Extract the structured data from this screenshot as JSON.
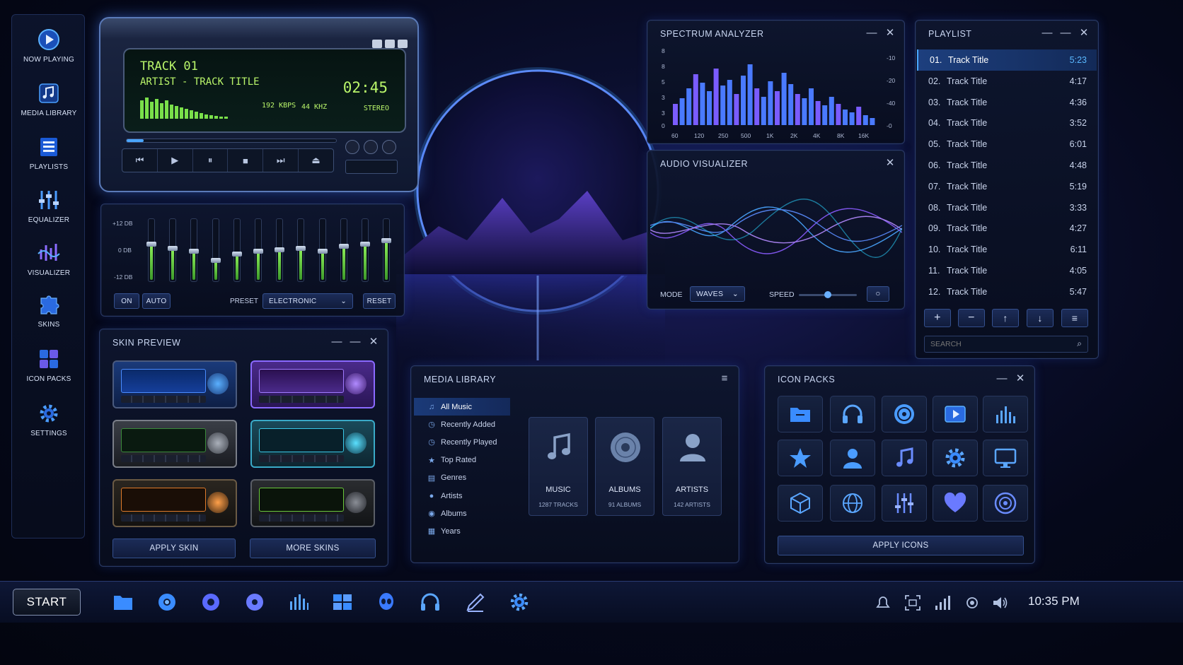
{
  "sidebar": {
    "items": [
      {
        "label": "NOW PLAYING",
        "icon": "play-circle-icon"
      },
      {
        "label": "MEDIA LIBRARY",
        "icon": "music-note-icon"
      },
      {
        "label": "PLAYLISTS",
        "icon": "list-icon"
      },
      {
        "label": "EQUALIZER",
        "icon": "equalizer-icon"
      },
      {
        "label": "VISUALIZER",
        "icon": "visualizer-icon"
      },
      {
        "label": "SKINS",
        "icon": "puzzle-icon"
      },
      {
        "label": "ICON PACKS",
        "icon": "grid-icon"
      },
      {
        "label": "SETTINGS",
        "icon": "gear-icon"
      }
    ]
  },
  "player": {
    "track_no": "TRACK 01",
    "track_info": "ARTIST - TRACK TITLE",
    "time": "02:45",
    "bitrate": "192 KBPS",
    "samplerate": "44 KHZ",
    "mode": "STEREO"
  },
  "equalizer": {
    "top": "+12 DB",
    "mid": "0 DB",
    "bottom": "-12 DB",
    "on_label": "ON",
    "auto_label": "AUTO",
    "preset_label": "PRESET",
    "preset_value": "ELECTRONIC",
    "reset_label": "RESET",
    "levels": [
      0.62,
      0.55,
      0.5,
      0.35,
      0.45,
      0.5,
      0.52,
      0.55,
      0.5,
      0.58,
      0.62,
      0.68
    ]
  },
  "skin_preview": {
    "title": "SKIN PREVIEW",
    "apply_label": "APPLY SKIN",
    "more_label": "MORE SKINS"
  },
  "spectrum": {
    "title": "SPECTRUM ANALYZER",
    "y_ticks": [
      "8",
      "8",
      "5",
      "3",
      "3",
      "0"
    ],
    "right_ticks": [
      "-10",
      "-20",
      "-40",
      "-0"
    ],
    "x_ticks": [
      "60",
      "120",
      "250",
      "500",
      "1K",
      "2K",
      "4K",
      "8K",
      "16K"
    ]
  },
  "visualizer": {
    "title": "AUDIO VISUALIZER",
    "mode_label": "MODE",
    "mode_value": "WAVES",
    "speed_label": "SPEED",
    "speed_level": 0.5
  },
  "playlist": {
    "title": "PLAYLIST",
    "tracks": [
      {
        "num": "01.",
        "title": "Track Title",
        "dur": "5:23"
      },
      {
        "num": "02.",
        "title": "Track Title",
        "dur": "4:17"
      },
      {
        "num": "03.",
        "title": "Track Title",
        "dur": "4:36"
      },
      {
        "num": "04.",
        "title": "Track Title",
        "dur": "3:52"
      },
      {
        "num": "05.",
        "title": "Track Title",
        "dur": "6:01"
      },
      {
        "num": "06.",
        "title": "Track Title",
        "dur": "4:48"
      },
      {
        "num": "07.",
        "title": "Track Title",
        "dur": "5:19"
      },
      {
        "num": "08.",
        "title": "Track Title",
        "dur": "3:33"
      },
      {
        "num": "09.",
        "title": "Track Title",
        "dur": "4:27"
      },
      {
        "num": "10.",
        "title": "Track Title",
        "dur": "6:11"
      },
      {
        "num": "11.",
        "title": "Track Title",
        "dur": "4:05"
      },
      {
        "num": "12.",
        "title": "Track Title",
        "dur": "5:47"
      }
    ],
    "search_placeholder": "SEARCH"
  },
  "media_library": {
    "title": "MEDIA LIBRARY",
    "nav": [
      {
        "label": "All Music",
        "icon": "music-note-icon"
      },
      {
        "label": "Recently Added",
        "icon": "clock-icon"
      },
      {
        "label": "Recently Played",
        "icon": "clock-icon"
      },
      {
        "label": "Top Rated",
        "icon": "star-icon"
      },
      {
        "label": "Genres",
        "icon": "tag-icon"
      },
      {
        "label": "Artists",
        "icon": "user-icon"
      },
      {
        "label": "Albums",
        "icon": "disc-icon"
      },
      {
        "label": "Years",
        "icon": "calendar-icon"
      }
    ],
    "cards": [
      {
        "title": "MUSIC",
        "sub": "1287 TRACKS"
      },
      {
        "title": "ALBUMS",
        "sub": "91 ALBUMS"
      },
      {
        "title": "ARTISTS",
        "sub": "142 ARTISTS"
      }
    ]
  },
  "icon_packs": {
    "title": "ICON PACKS",
    "apply_label": "APPLY ICONS",
    "icons": [
      "folder-icon",
      "headphones-icon",
      "disc-icon",
      "video-play-icon",
      "equalizer-icon",
      "star-icon",
      "user-icon",
      "music-note-icon",
      "gear-icon",
      "monitor-icon",
      "cube-icon",
      "globe-icon",
      "sliders-icon",
      "heart-icon",
      "speaker-icon"
    ]
  },
  "taskbar": {
    "start_label": "START",
    "clock": "10:35 PM"
  },
  "colors": {
    "accent": "#4a8cff",
    "lcd_green": "#b9f56a",
    "purple": "#8b5cf6"
  }
}
